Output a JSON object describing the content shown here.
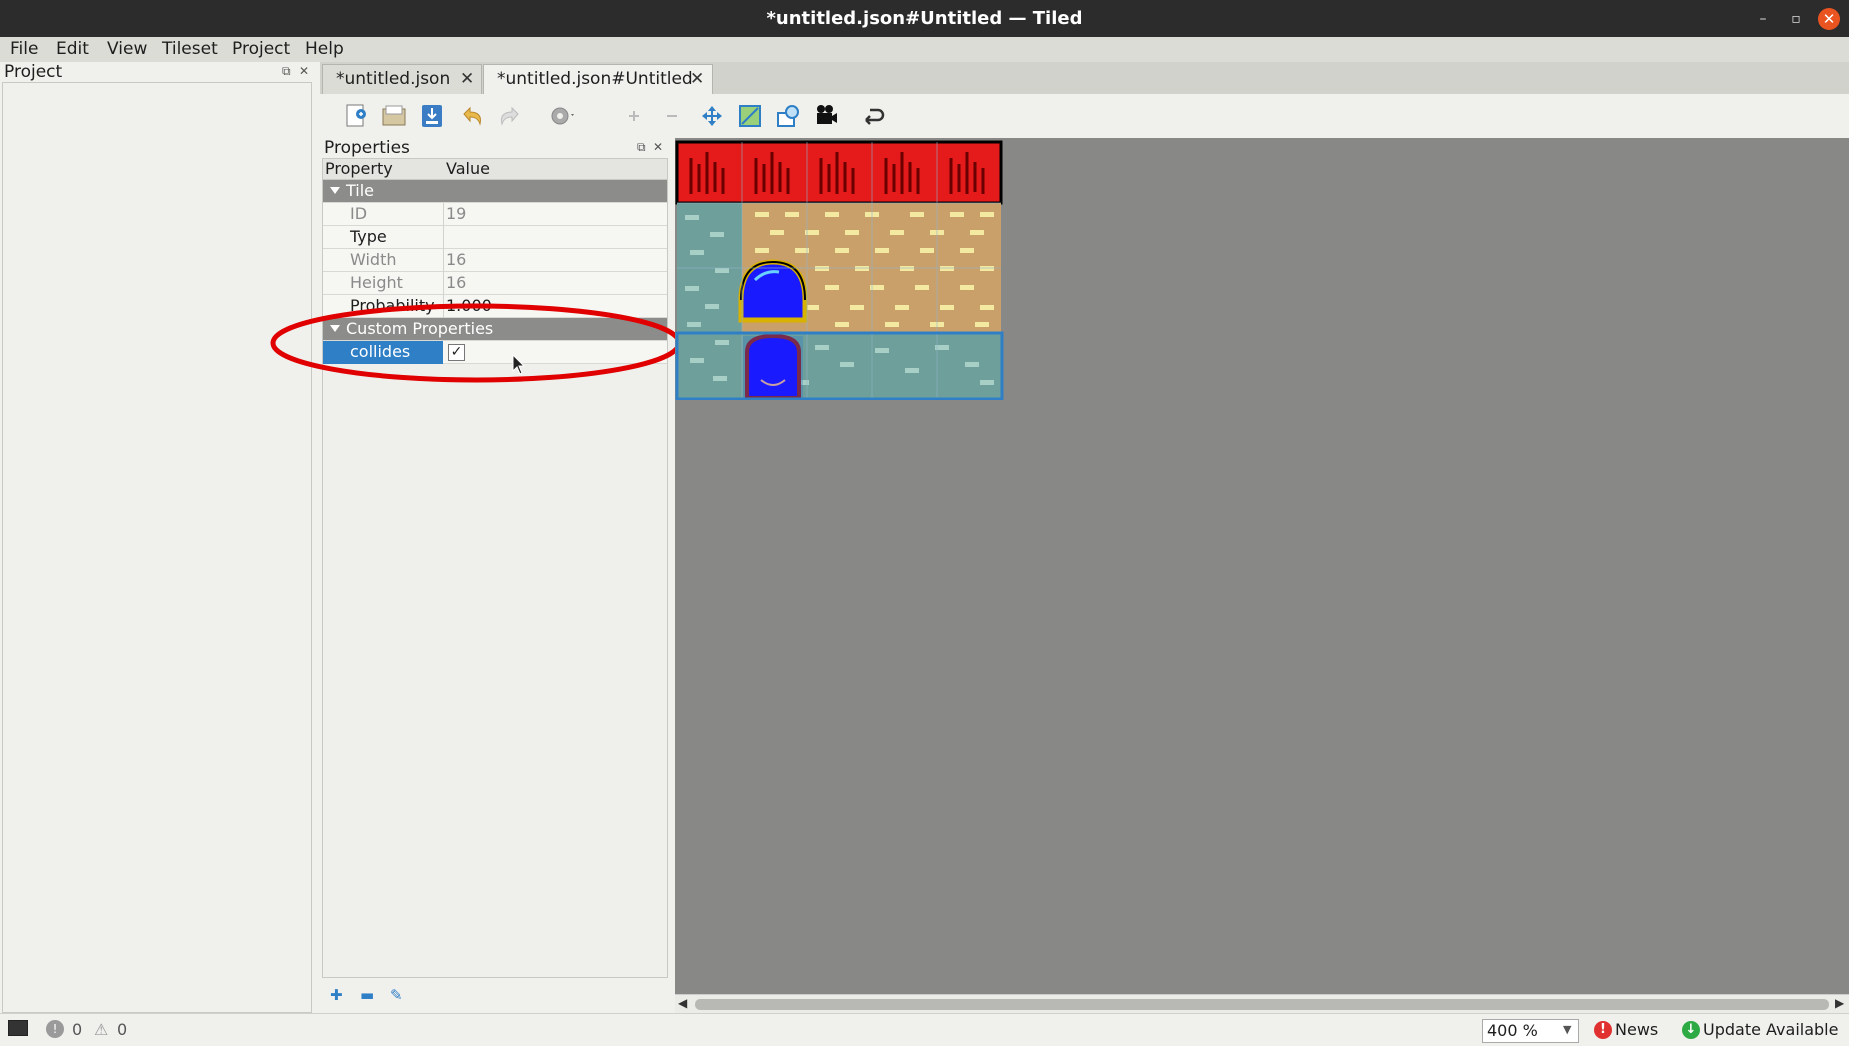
{
  "window": {
    "title": "*untitled.json#Untitled — Tiled"
  },
  "menu": [
    "File",
    "Edit",
    "View",
    "Tileset",
    "Project",
    "Help"
  ],
  "project_dock": {
    "title": "Project"
  },
  "tabs": [
    {
      "label": "*untitled.json"
    },
    {
      "label": "*untitled.json#Untitled"
    }
  ],
  "toolbar_icons": [
    "new-tileset-icon",
    "open-icon",
    "save-icon",
    "undo-icon",
    "redo-icon",
    "tileset-properties-icon",
    "add-tiles-icon",
    "remove-tiles-icon",
    "rearrange-icon",
    "terrain-icon",
    "collision-editor-icon",
    "animation-editor-icon",
    "dynamic-wrapping-icon"
  ],
  "properties": {
    "title": "Properties",
    "header": {
      "property": "Property",
      "value": "Value"
    },
    "tile_group": "Tile",
    "rows": [
      {
        "key": "ID",
        "value": "19",
        "enabled": false
      },
      {
        "key": "Type",
        "value": "",
        "enabled": true
      },
      {
        "key": "Width",
        "value": "16",
        "enabled": false
      },
      {
        "key": "Height",
        "value": "16",
        "enabled": false
      },
      {
        "key": "Probability",
        "value": "1.000",
        "enabled": true
      }
    ],
    "custom_group": "Custom Properties",
    "custom": [
      {
        "key": "collides",
        "value": true
      }
    ]
  },
  "annotation": {
    "color": "#e00000",
    "shape": "ellipse"
  },
  "status": {
    "errors": "0",
    "warnings": "0",
    "zoom": "400 %",
    "news": "News",
    "update": "Update Available"
  },
  "colors": {
    "selection": "#2f7fc6",
    "canvas": "#888886",
    "roof": "#e51a1a",
    "wall": "#caa06a",
    "stone": "#6f9f9a"
  }
}
